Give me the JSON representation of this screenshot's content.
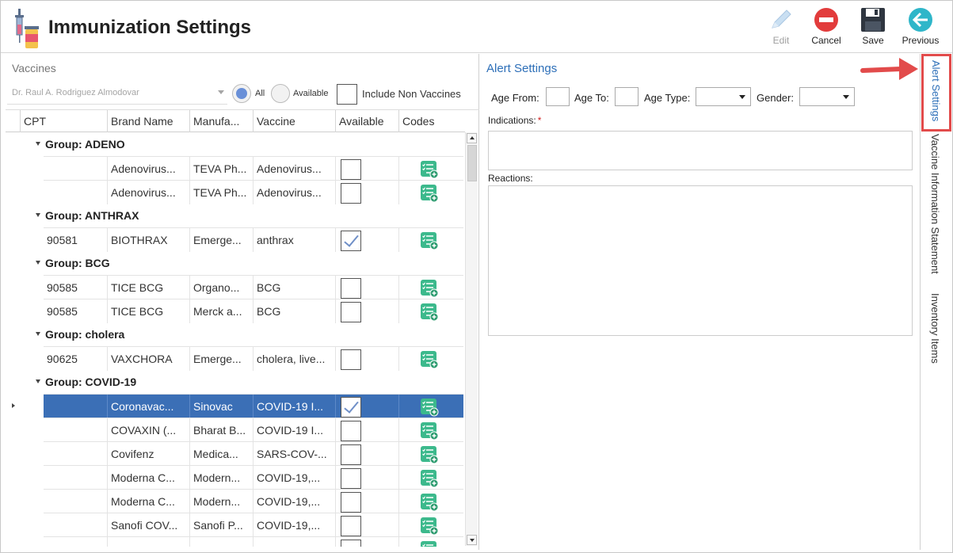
{
  "app": {
    "title": "Immunization Settings"
  },
  "toolbar": {
    "edit_label": "Edit",
    "cancel_label": "Cancel",
    "save_label": "Save",
    "previous_label": "Previous"
  },
  "vaccines": {
    "section_title": "Vaccines",
    "doctor": "Dr. Raul A. Rodriguez Almodovar",
    "filter_all": "All",
    "filter_available": "Available",
    "include_non_vaccines": "Include Non Vaccines",
    "columns": [
      "CPT",
      "Brand Name",
      "Manufa...",
      "Vaccine",
      "Available",
      "Codes"
    ],
    "groups": [
      {
        "label": "Group: ADENO",
        "rows": [
          {
            "cpt": "",
            "brand": "Adenovirus...",
            "manufacturer": "TEVA Ph...",
            "vaccine": "Adenovirus...",
            "available": false
          },
          {
            "cpt": "",
            "brand": "Adenovirus...",
            "manufacturer": "TEVA Ph...",
            "vaccine": "Adenovirus...",
            "available": false
          }
        ]
      },
      {
        "label": "Group: ANTHRAX",
        "rows": [
          {
            "cpt": "90581",
            "brand": "BIOTHRAX",
            "manufacturer": "Emerge...",
            "vaccine": "anthrax",
            "available": true
          }
        ]
      },
      {
        "label": "Group: BCG",
        "rows": [
          {
            "cpt": "90585",
            "brand": "TICE BCG",
            "manufacturer": "Organo...",
            "vaccine": "BCG",
            "available": false
          },
          {
            "cpt": "90585",
            "brand": "TICE BCG",
            "manufacturer": "Merck a...",
            "vaccine": "BCG",
            "available": false
          }
        ]
      },
      {
        "label": "Group: cholera",
        "rows": [
          {
            "cpt": "90625",
            "brand": "VAXCHORA",
            "manufacturer": "Emerge...",
            "vaccine": "cholera, live...",
            "available": false
          }
        ]
      },
      {
        "label": "Group: COVID-19",
        "rows": [
          {
            "cpt": "",
            "brand": "Coronavac...",
            "manufacturer": "Sinovac",
            "vaccine": "COVID-19 I...",
            "available": true,
            "selected": true
          },
          {
            "cpt": "",
            "brand": "COVAXIN (...",
            "manufacturer": "Bharat B...",
            "vaccine": "COVID-19 I...",
            "available": false
          },
          {
            "cpt": "",
            "brand": "Covifenz",
            "manufacturer": "Medica...",
            "vaccine": "SARS-COV-...",
            "available": false
          },
          {
            "cpt": "",
            "brand": "Moderna C...",
            "manufacturer": "Modern...",
            "vaccine": "COVID-19,...",
            "available": false
          },
          {
            "cpt": "",
            "brand": "Moderna C...",
            "manufacturer": "Modern...",
            "vaccine": "COVID-19,...",
            "available": false
          },
          {
            "cpt": "",
            "brand": "Sanofi COV...",
            "manufacturer": "Sanofi P...",
            "vaccine": "COVID-19,...",
            "available": false
          },
          {
            "cpt": "",
            "brand": "",
            "manufacturer": "",
            "vaccine": "",
            "available": false
          }
        ]
      }
    ]
  },
  "alert": {
    "title": "Alert Settings",
    "age_from_label": "Age From:",
    "age_to_label": "Age To:",
    "age_type_label": "Age Type:",
    "gender_label": "Gender:",
    "indications_label": "Indications:",
    "required_mark": "*",
    "reactions_label": "Reactions:"
  },
  "side_tabs": [
    "Alert Settings",
    "Vaccine Information Statement",
    "Inventory Items"
  ],
  "colors": {
    "accent": "#2d6fb8",
    "selected_row": "#3b6fb6",
    "highlight": "#e24b4b",
    "codes_icon": "#3cb98c"
  }
}
